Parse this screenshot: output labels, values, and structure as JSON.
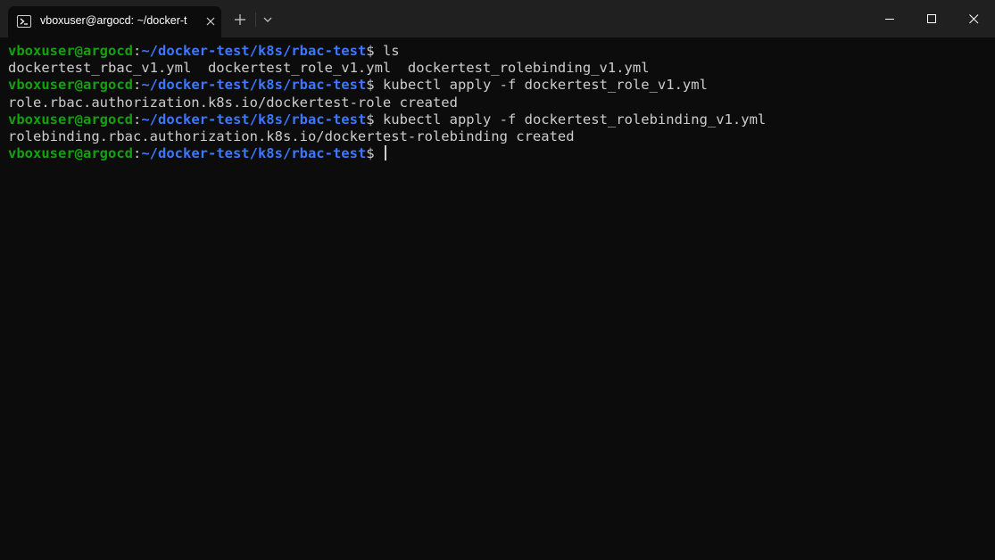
{
  "tab": {
    "title": "vboxuser@argocd: ~/docker-t",
    "icon": "powershell-terminal-icon"
  },
  "titlebar": {
    "new_tab_icon": "plus-icon",
    "dropdown_icon": "chevron-down-icon",
    "minimize_icon": "minimize-icon",
    "maximize_icon": "maximize-icon",
    "close_icon": "close-icon"
  },
  "colors": {
    "user": "#13a10e",
    "path": "#3b78ff",
    "text": "#cccccc",
    "background": "#0c0c0c"
  },
  "terminal": {
    "lines": [
      {
        "type": "prompt",
        "user": "vboxuser@argocd",
        "sep": ":",
        "path": "~/docker-test/k8s/rbac-test",
        "dollar": "$ ",
        "cmd": "ls"
      },
      {
        "type": "output",
        "text": "dockertest_rbac_v1.yml  dockertest_role_v1.yml  dockertest_rolebinding_v1.yml"
      },
      {
        "type": "prompt",
        "user": "vboxuser@argocd",
        "sep": ":",
        "path": "~/docker-test/k8s/rbac-test",
        "dollar": "$ ",
        "cmd": "kubectl apply -f dockertest_role_v1.yml"
      },
      {
        "type": "output",
        "text": "role.rbac.authorization.k8s.io/dockertest-role created"
      },
      {
        "type": "prompt",
        "user": "vboxuser@argocd",
        "sep": ":",
        "path": "~/docker-test/k8s/rbac-test",
        "dollar": "$ ",
        "cmd": "kubectl apply -f dockertest_rolebinding_v1.yml"
      },
      {
        "type": "output",
        "text": "rolebinding.rbac.authorization.k8s.io/dockertest-rolebinding created"
      },
      {
        "type": "prompt",
        "user": "vboxuser@argocd",
        "sep": ":",
        "path": "~/docker-test/k8s/rbac-test",
        "dollar": "$ ",
        "cmd": ""
      }
    ]
  }
}
